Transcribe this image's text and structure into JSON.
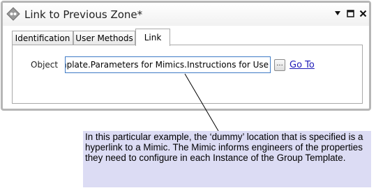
{
  "window": {
    "title": "Link to Previous Zone*",
    "controls": {
      "dropdown_icon": "chevron-down-icon",
      "maximize_icon": "maximize-icon",
      "close_icon": "close-icon"
    }
  },
  "tabs": [
    {
      "label": "Identification",
      "active": false
    },
    {
      "label": "User Methods",
      "active": false
    },
    {
      "label": "Link",
      "active": true
    }
  ],
  "link_panel": {
    "object_label": "Object",
    "object_value": "nplate.Parameters for Mimics.Instructions for Use",
    "browse_label": "...",
    "goto_label": "Go To"
  },
  "callout": {
    "text": "In this particular example, the ‘dummy’ location that is specified is a hyperlink to a Mimic. The Mimic informs engineers of the properties they need to configure in each Instance of the Group Template."
  },
  "colors": {
    "window_border": "#b6b6b6",
    "input_focus_border": "#3f7bc6",
    "link_color": "#1d1ab8",
    "callout_background": "#dcdcf4"
  }
}
